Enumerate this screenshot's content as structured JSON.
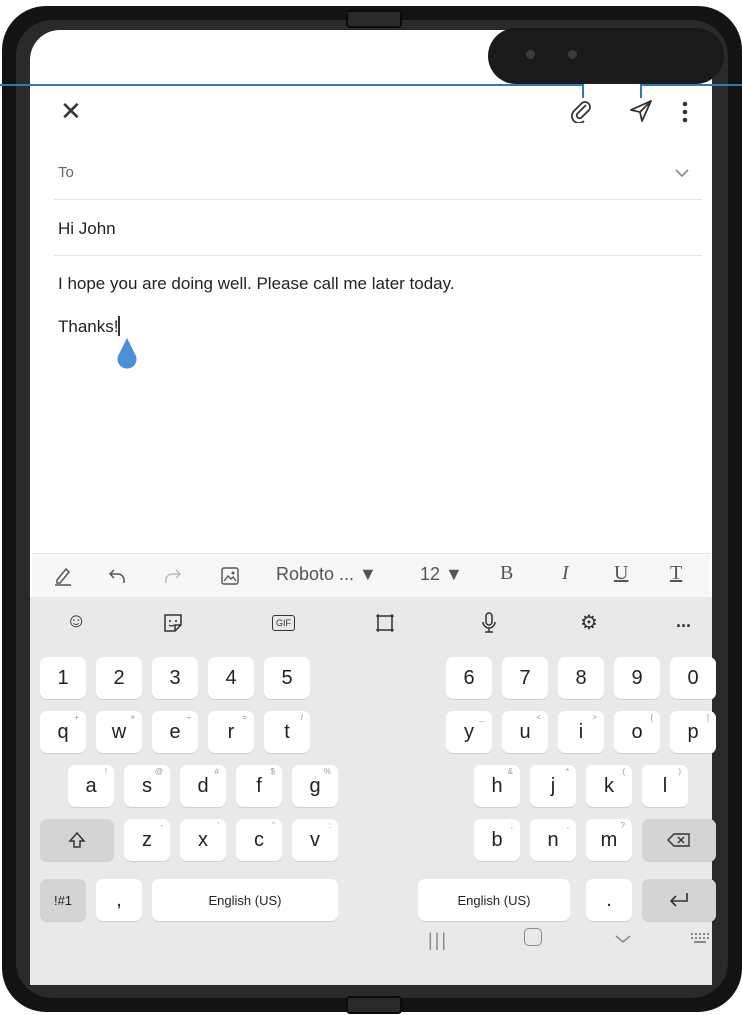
{
  "email": {
    "to_label": "To",
    "subject": "Hi John",
    "body_line1": "I hope you are doing well. Please call me later today.",
    "body_line2": "Thanks!"
  },
  "toolbar": {
    "font": "Roboto ... ▼",
    "size": "12 ▼",
    "bold": "B",
    "italic": "I",
    "underline": "U",
    "clear": "T"
  },
  "keyboard": {
    "gif": "GIF",
    "more": "...",
    "numbers_left": [
      "1",
      "2",
      "3",
      "4",
      "5"
    ],
    "numbers_right": [
      "6",
      "7",
      "8",
      "9",
      "0"
    ],
    "row1_left": [
      "q",
      "w",
      "e",
      "r",
      "t"
    ],
    "row1_left_sub": [
      "+",
      "×",
      "÷",
      "=",
      "/"
    ],
    "row1_right": [
      "y",
      "u",
      "i",
      "o",
      "p"
    ],
    "row1_right_sub": [
      "_",
      "<",
      ">",
      "[",
      "]"
    ],
    "row2_left": [
      "a",
      "s",
      "d",
      "f",
      "g"
    ],
    "row2_left_sub": [
      "!",
      "@",
      "#",
      "$",
      "%"
    ],
    "row2_right": [
      "h",
      "j",
      "k",
      "l"
    ],
    "row2_right_sub": [
      "&",
      "*",
      "(",
      ")"
    ],
    "row3_left": [
      "z",
      "x",
      "c",
      "v"
    ],
    "row3_left_sub": [
      "-",
      "'",
      "\"",
      ":"
    ],
    "row3_right": [
      "b",
      "n",
      "m"
    ],
    "row3_right_sub": [
      ";",
      ",",
      "?"
    ],
    "sym": "!#1",
    "comma": ",",
    "space_left": "English (US)",
    "space_right": "English (US)",
    "period": "."
  },
  "colors": {
    "accent": "#2b7ab8",
    "cursor_handle": "#4a90d9"
  }
}
